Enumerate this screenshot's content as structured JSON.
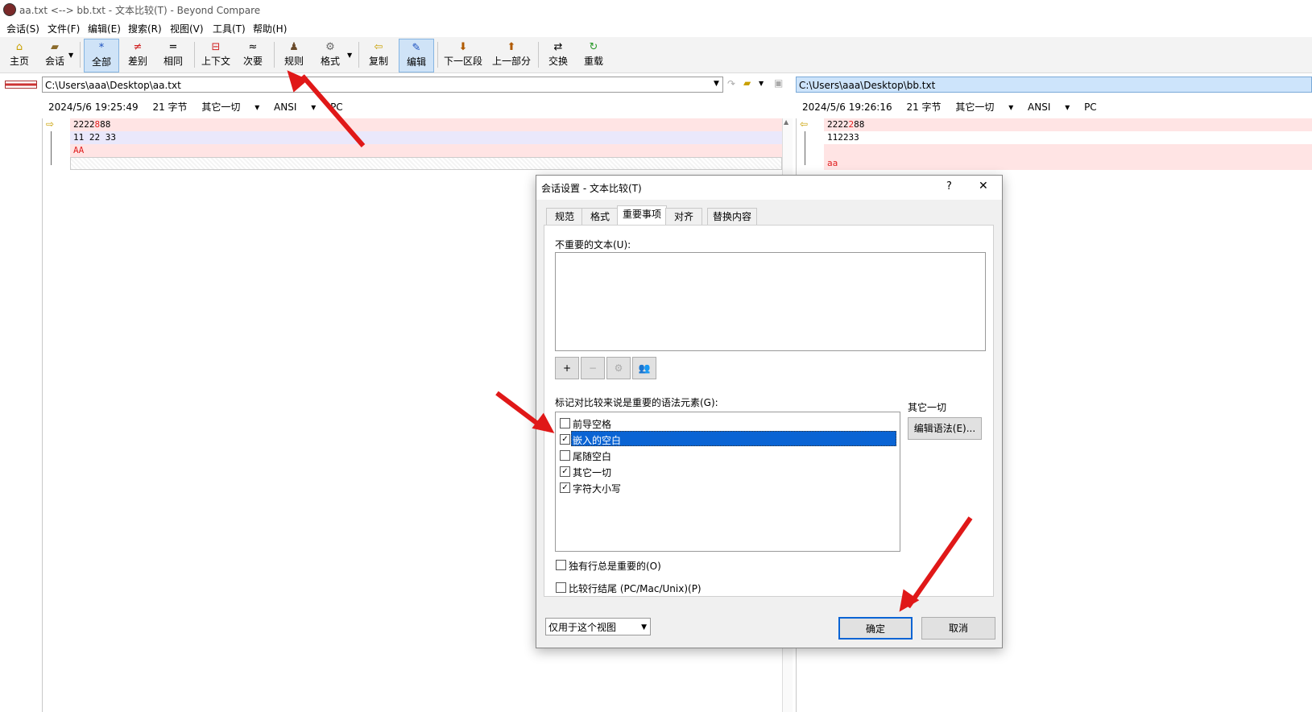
{
  "window": {
    "title": "aa.txt <--> bb.txt - 文本比较(T) - Beyond Compare"
  },
  "menu": [
    "会话(S)",
    "文件(F)",
    "编辑(E)",
    "搜索(R)",
    "视图(V)",
    "工具(T)",
    "帮助(H)"
  ],
  "toolbar": {
    "home": "主页",
    "session": "会话",
    "all": "全部",
    "diffs": "差别",
    "same": "相同",
    "context": "上下文",
    "minor": "次要",
    "rules": "规则",
    "format": "格式",
    "copy": "复制",
    "edit": "编辑",
    "next_section": "下一区段",
    "prev_section": "上一部分",
    "swap": "交换",
    "reload": "重载"
  },
  "left": {
    "path": "C:\\Users\\aaa\\Desktop\\aa.txt",
    "timestamp": "2024/5/6 19:25:49",
    "size": "21 字节",
    "rule": "其它一切",
    "encoding": "ANSI",
    "eol": "PC",
    "lines": [
      {
        "pre": "2222",
        "hl": "8",
        "post": "88"
      },
      {
        "pre": "11 22 33",
        "hl": "",
        "post": ""
      },
      {
        "pre": "",
        "hl": "AA",
        "post": ""
      }
    ]
  },
  "right": {
    "path": "C:\\Users\\aaa\\Desktop\\bb.txt",
    "timestamp": "2024/5/6 19:26:16",
    "size": "21 字节",
    "rule": "其它一切",
    "encoding": "ANSI",
    "eol": "PC",
    "lines": [
      {
        "pre": "2222",
        "hl": "2",
        "post": "88"
      },
      {
        "pre": "112233",
        "hl": "",
        "post": ""
      },
      {
        "pre": "",
        "hl": "",
        "post": ""
      },
      {
        "pre": "",
        "hl": "aa",
        "post": ""
      }
    ]
  },
  "dialog": {
    "title": "会话设置 - 文本比较(T)",
    "help": "?",
    "close": "✕",
    "tabs": [
      "规范",
      "格式",
      "重要事项",
      "对齐",
      "替换内容"
    ],
    "unimportant_label": "不重要的文本(U):",
    "grammar_label": "标记对比较来说是重要的语法元素(G):",
    "items": [
      {
        "label": "前导空格",
        "checked": false
      },
      {
        "label": "嵌入的空白",
        "checked": true,
        "selected": true
      },
      {
        "label": "尾随空白",
        "checked": false
      },
      {
        "label": "其它一切",
        "checked": true
      },
      {
        "label": "字符大小写",
        "checked": true
      }
    ],
    "side_label": "其它一切",
    "edit_grammar": "编辑语法(E)...",
    "orphan": "独有行总是重要的(O)",
    "eol": "比较行结尾 (PC/Mac/Unix)(P)",
    "scope": "仅用于这个视图",
    "ok": "确定",
    "cancel": "取消"
  },
  "colors": {
    "arrow": "#e01818",
    "selection": "#0a64d4",
    "diff_pink": "#ffe4e4",
    "diff_lavender": "#eae8fb"
  }
}
